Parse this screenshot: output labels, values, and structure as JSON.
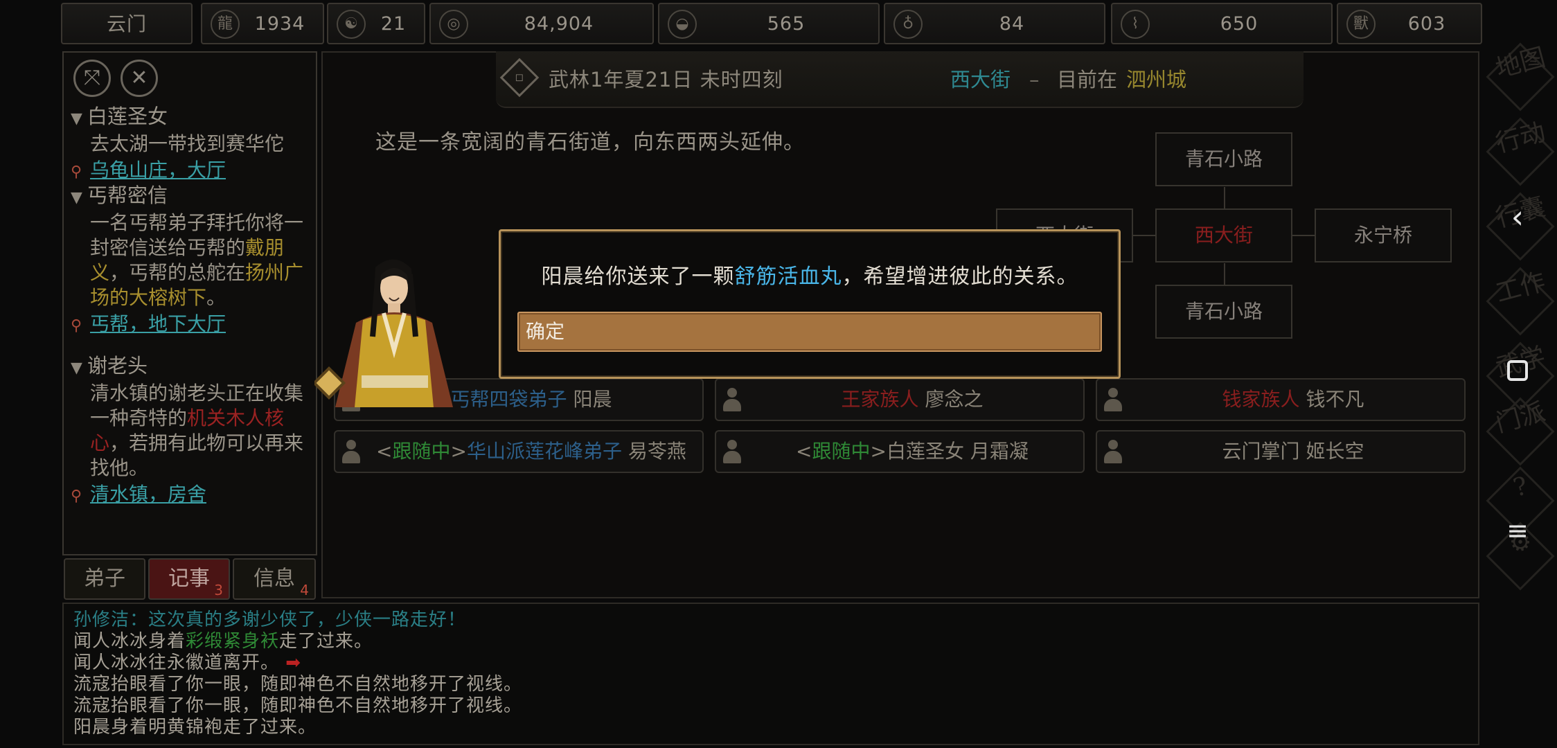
{
  "topbar": {
    "sect": "云门",
    "resources": [
      {
        "icon": "dragon-icon",
        "value": "1934"
      },
      {
        "icon": "yinyang-icon",
        "value": "21"
      },
      {
        "icon": "coin-icon",
        "value": "84,904"
      },
      {
        "icon": "rice-bowl-icon",
        "value": "565"
      },
      {
        "icon": "gourd-icon",
        "value": "84"
      },
      {
        "icon": "scroll-icon",
        "value": "650"
      },
      {
        "icon": "beast-icon",
        "value": "603"
      }
    ]
  },
  "quests": [
    {
      "title": "白莲圣女",
      "desc_parts": [
        "去太湖一带找到赛华佗"
      ],
      "location": "乌龟山庄，大厅"
    },
    {
      "title": "丐帮密信",
      "desc_1": "一名丐帮弟子拜托你将一封密信送给丐帮的",
      "desc_hl1": "戴朋义",
      "desc_2": "，丐帮的总舵在",
      "desc_hl2": "扬州广场的大榕树下",
      "desc_3": "。",
      "location": "丐帮，地下大厅"
    },
    {
      "title": "谢老头",
      "desc_1": "清水镇的谢老头正在收集一种奇特的",
      "desc_hl1": "机关木人核心",
      "desc_2": "，若拥有此物可以再来找他。",
      "location": "清水镇，房舍"
    }
  ],
  "left_tabs": {
    "disciples": "弟子",
    "records": "记事",
    "records_badge": "3",
    "info": "信息",
    "info_badge": "4"
  },
  "header": {
    "date": "武林1年夏21日 未时四刻",
    "street": "西大街",
    "separator": "–",
    "prefix": "目前在",
    "city": "泗州城"
  },
  "scene": {
    "description": "这是一条宽阔的青石街道，向东西两头延伸。"
  },
  "map": {
    "north": "青石小路",
    "west": "西大街",
    "current": "西大街",
    "east": "永宁桥",
    "south": "青石小路"
  },
  "npcs": [
    {
      "title": "丐帮四袋弟子",
      "name": "阳晨"
    },
    {
      "title": "王家族人",
      "name": "廖念之"
    },
    {
      "title": "钱家族人",
      "name": "钱不凡"
    },
    {
      "tag": "跟随中",
      "title": "华山派莲花峰弟子",
      "name": "易苓燕"
    },
    {
      "tag": "跟随中",
      "title": "白莲圣女",
      "name": "月霜凝"
    },
    {
      "title": "云门掌门",
      "name": "姬长空"
    }
  ],
  "dialog": {
    "msg_before": "阳晨给你送来了一颗",
    "item": "舒筋活血丸",
    "msg_after": "，希望增进彼此的关系。",
    "ok_label": "确定"
  },
  "log": [
    "孙修洁：这次真的多谢少侠了，少侠一路走好！",
    "闻人冰冰身着",
    "彩缎紧身袄",
    "走了过来。",
    "闻人冰冰往永徽道离开。",
    "流寇抬眼看了你一眼，随即神色不自然地移开了视线。",
    "流寇抬眼看了你一眼，随即神色不自然地移开了视线。",
    "阳晨身着明黄锦袍走了过来。"
  ],
  "right_menu": [
    "地图",
    "行动",
    "行囊",
    "工作",
    "武学",
    "门派",
    "?",
    "设置"
  ],
  "colors": {
    "accent_gold": "#b7935a",
    "button_brown": "#a5733f",
    "teal": "#2f8a92",
    "item_blue": "#4ab6e8",
    "follow_green": "#2f8a36",
    "clan_red": "#8a1e1e"
  }
}
